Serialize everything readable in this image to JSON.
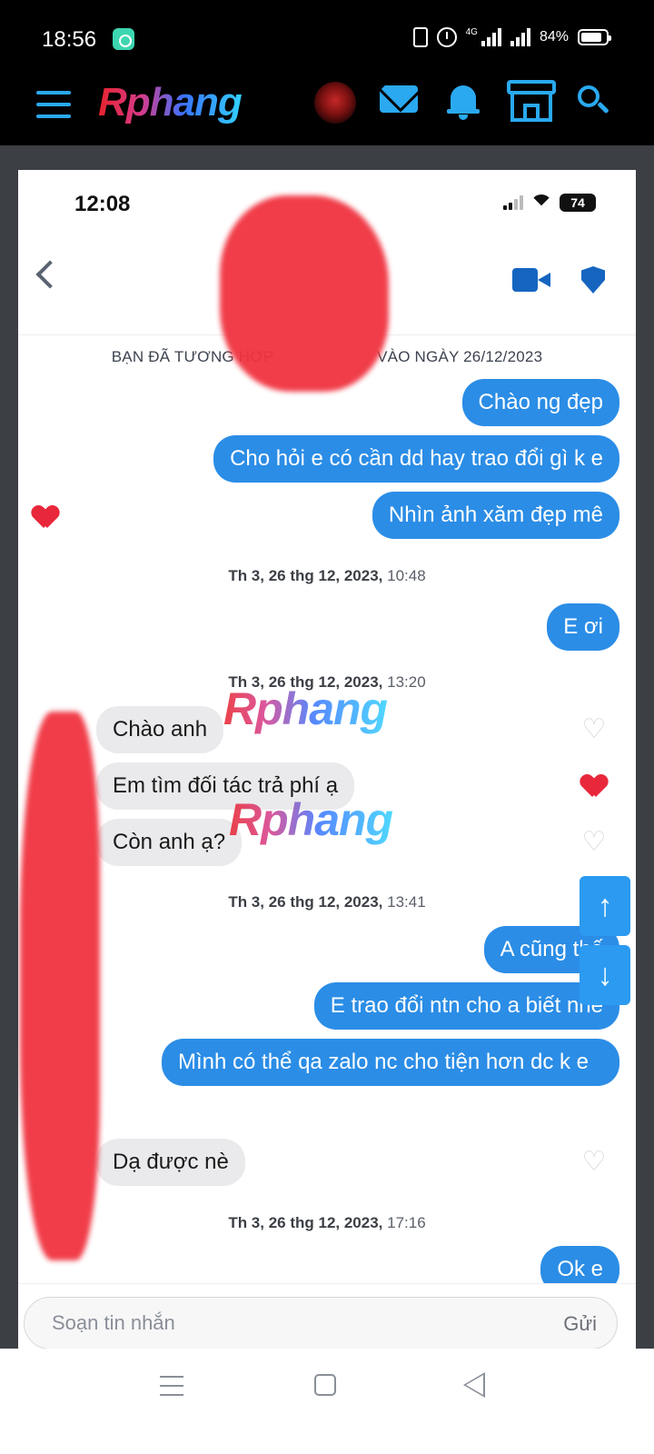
{
  "system": {
    "time": "18:56",
    "network": "4G",
    "battery": "84%"
  },
  "site": {
    "logo": "Rphang"
  },
  "screenshot": {
    "status": {
      "time": "12:08",
      "battery": "74"
    },
    "match_note": "BẠN ĐÃ TƯƠNG HỢP VỚI … VÀO NGÀY 26/12/2023",
    "match_note_left": "BẠN ĐÃ TƯƠNG HỢP",
    "match_note_right": "VÀO NGÀY 26/12/2023",
    "messages_block1": [
      "Chào ng đẹp",
      "Cho hỏi e có cần dd hay trao đổi gì k e",
      "Nhìn ảnh xăm đẹp mê"
    ],
    "stamp1": {
      "date": "Th 3, 26 thg 12, 2023,",
      "time": "10:48"
    },
    "msg_eoi": "E ơi",
    "stamp2": {
      "date": "Th 3, 26 thg 12, 2023,",
      "time": "13:20"
    },
    "incoming1": [
      "Chào anh",
      "Em tìm đối tác trả phí ạ",
      "Còn anh ạ?"
    ],
    "stamp3": {
      "date": "Th 3, 26 thg 12, 2023,",
      "time": "13:41"
    },
    "outgoing2": [
      "A cũng thế",
      "E trao đổi ntn cho a biết nhé",
      "Mình có thể qa zalo nc cho tiện hơn dc k e"
    ],
    "incoming2": "Dạ được nè",
    "stamp4": {
      "date": "Th 3, 26 thg 12, 2023,",
      "time": "17:16"
    },
    "last_out": "Ok e",
    "composer": {
      "placeholder": "Soạn tin nhắn",
      "send": "Gửi"
    },
    "watermark": "Rphang"
  },
  "colors": {
    "accent": "#2aa9f0",
    "bubble_out": "#2b8de6",
    "bubble_in": "#eaeaec",
    "like": "#e8283a",
    "redaction": "#f03340"
  },
  "icons": [
    "menu-icon",
    "mail-icon",
    "bell-icon",
    "store-icon",
    "search-icon",
    "back-icon",
    "video-call-icon",
    "shield-icon",
    "heart-icon",
    "arrow-up-icon",
    "arrow-down-icon"
  ],
  "scroll_up_glyph": "↑",
  "scroll_down_glyph": "↓"
}
